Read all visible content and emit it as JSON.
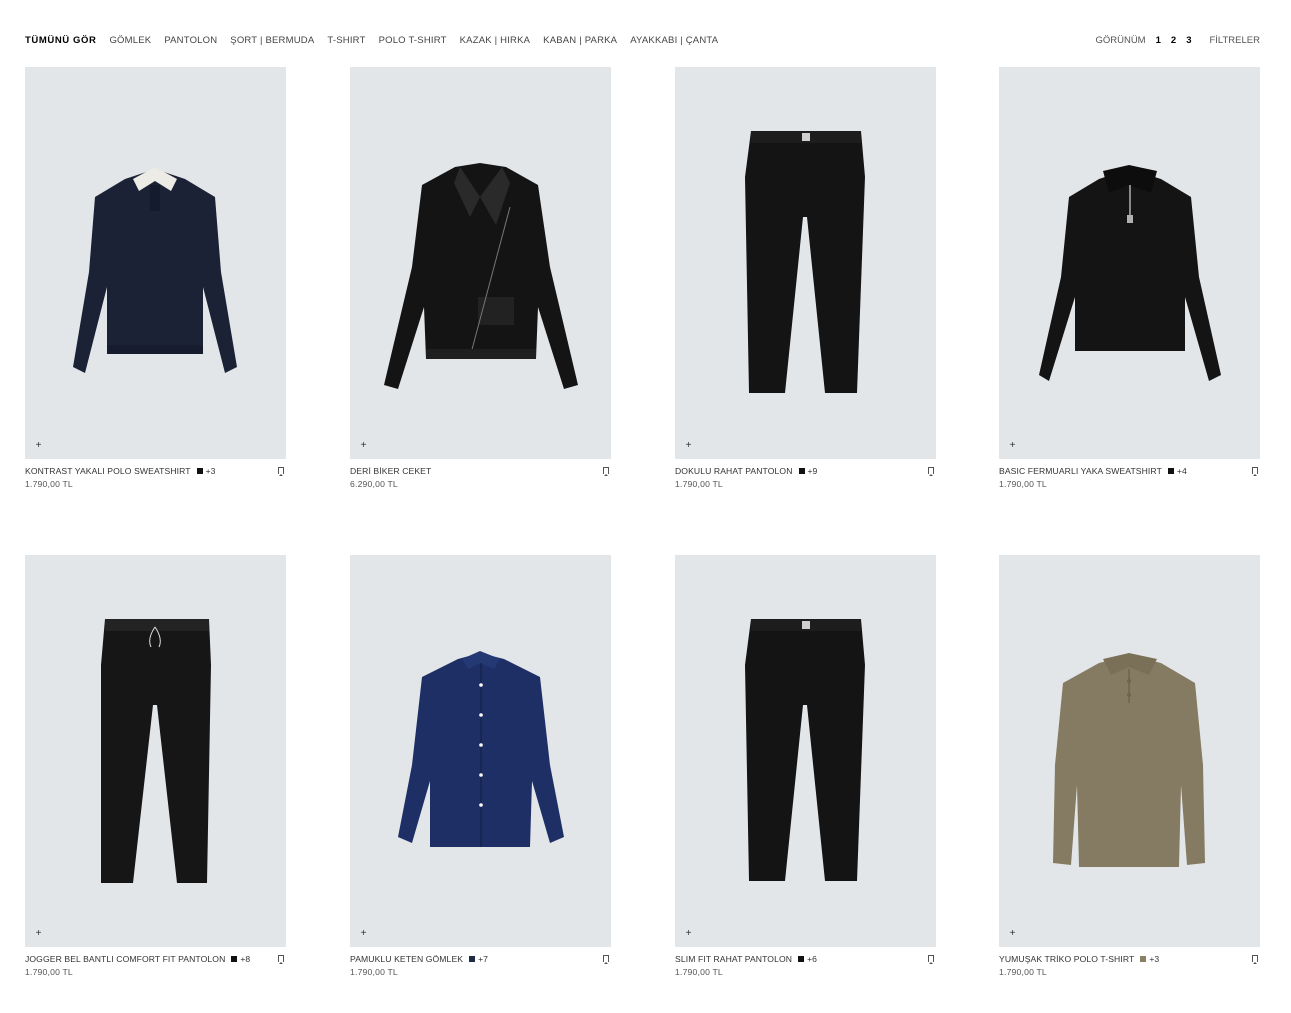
{
  "nav": {
    "categories": [
      "TÜMÜNÜ GÖR",
      "GÖMLEK",
      "PANTOLON",
      "ŞORT | BERMUDA",
      "T-SHIRT",
      "POLO T-SHIRT",
      "KAZAK | HIRKA",
      "KABAN | PARKA",
      "AYAKKABI | ÇANTA"
    ],
    "view_label": "GÖRÜNÜM",
    "view_options": [
      "1",
      "2",
      "3"
    ],
    "filters_label": "FİLTRELER"
  },
  "products": [
    {
      "name": "KONTRAST YAKALI POLO SWEATSHIRT",
      "swatch": "#111111",
      "more": "+3",
      "price": "1.790,00 TL",
      "icon": "navy-polo-sweatshirt",
      "bg": "#e3e6e9"
    },
    {
      "name": "DERİ BİKER CEKET",
      "swatch": "",
      "more": "",
      "price": "6.290,00 TL",
      "icon": "black-leather-jacket",
      "bg": "#e3e6e9"
    },
    {
      "name": "DOKULU RAHAT PANTOLON",
      "swatch": "#111111",
      "more": "+9",
      "price": "1.790,00 TL",
      "icon": "black-trousers",
      "bg": "#e3e6e9"
    },
    {
      "name": "BASIC FERMUARLI YAKA SWEATSHIRT",
      "swatch": "#111111",
      "more": "+4",
      "price": "1.790,00 TL",
      "icon": "black-zip-sweatshirt",
      "bg": "#e3e6e9"
    },
    {
      "name": "JOGGER BEL BANTLI COMFORT FIT PANTOLON",
      "swatch": "#111111",
      "more": "+8",
      "price": "1.790,00 TL",
      "icon": "black-jogger-trousers",
      "bg": "#e3e6e9"
    },
    {
      "name": "PAMUKLU KETEN GÖMLEK",
      "swatch": "#1f2a44",
      "more": "+7",
      "price": "1.790,00 TL",
      "icon": "navy-linen-shirt",
      "bg": "#e3e6e9"
    },
    {
      "name": "SLIM FIT RAHAT PANTOLON",
      "swatch": "#111111",
      "more": "+6",
      "price": "1.790,00 TL",
      "icon": "black-slim-trousers",
      "bg": "#e3e6e9"
    },
    {
      "name": "YUMUŞAK TRİKO POLO T-SHIRT",
      "swatch": "#8a8064",
      "more": "+3",
      "price": "1.790,00 TL",
      "icon": "khaki-knit-polo",
      "bg": "#e3e6e9"
    }
  ],
  "colors": {
    "card_bg": "#e3e6e9",
    "navy": "#1b2236",
    "black": "#141414",
    "khaki": "#857b62",
    "shirt_blue": "#1e2f66"
  }
}
